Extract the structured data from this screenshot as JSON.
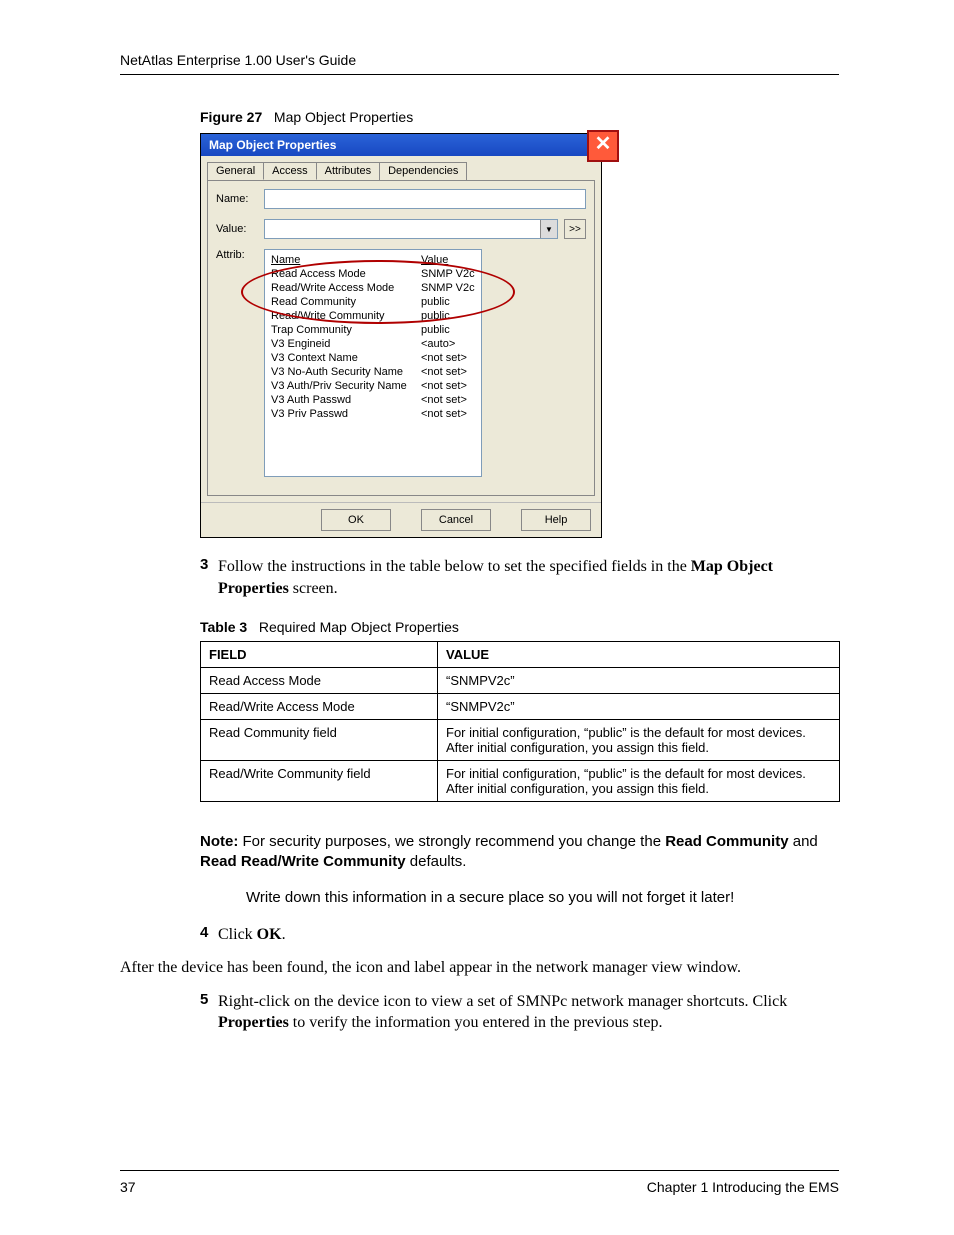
{
  "header": {
    "guide_title": "NetAtlas Enterprise 1.00 User's Guide"
  },
  "figure": {
    "label": "Figure 27",
    "title": "Map Object Properties"
  },
  "dialog": {
    "title": "Map Object Properties",
    "tabs": [
      "General",
      "Access",
      "Attributes",
      "Dependencies"
    ],
    "active_tab": 1,
    "labels": {
      "name": "Name:",
      "value": "Value:",
      "attrib": "Attrib:",
      "more": ">>"
    },
    "attrib_header": {
      "name": "Name",
      "value": "Value"
    },
    "attribs": [
      {
        "name": "Read Access Mode",
        "value": "SNMP V2c"
      },
      {
        "name": "Read/Write Access Mode",
        "value": "SNMP V2c"
      },
      {
        "name": "Read Community",
        "value": "public"
      },
      {
        "name": "Read/Write Community",
        "value": "public"
      },
      {
        "name": "Trap Community",
        "value": "public"
      },
      {
        "name": "V3 Engineid",
        "value": "<auto>"
      },
      {
        "name": "V3 Context Name",
        "value": "<not set>"
      },
      {
        "name": "V3 No-Auth Security Name",
        "value": "<not set>"
      },
      {
        "name": "V3 Auth/Priv Security Name",
        "value": "<not set>"
      },
      {
        "name": "V3 Auth Passwd",
        "value": "<not set>"
      },
      {
        "name": "V3 Priv Passwd",
        "value": "<not set>"
      }
    ],
    "buttons": {
      "ok": "OK",
      "cancel": "Cancel",
      "help": "Help"
    }
  },
  "step3": {
    "num": "3",
    "text_a": "Follow the instructions in the table below to set the specified fields in the ",
    "bold": "Map Object Properties",
    "text_b": " screen."
  },
  "table_caption": {
    "label": "Table 3",
    "title": "Required Map Object Properties"
  },
  "table": {
    "head": {
      "field": "FIELD",
      "value": "VALUE"
    },
    "rows": [
      {
        "field": "Read Access Mode",
        "value": "“SNMPV2c”"
      },
      {
        "field": "Read/Write Access Mode",
        "value": "“SNMPV2c”"
      },
      {
        "field": "Read Community field",
        "value": "For initial configuration, “public” is the default for most devices. After initial configuration, you assign this field."
      },
      {
        "field": "Read/Write Community field",
        "value": "For initial configuration, “public” is the default for most devices. After initial configuration, you assign this field."
      }
    ]
  },
  "note": {
    "prefix": "Note: ",
    "line1_a": "For security purposes, we strongly recommend you change the ",
    "bold1": "Read Community",
    "mid": " and ",
    "bold2": "Read Read/Write Community",
    "line1_b": " defaults.",
    "line2": "Write down this information in a secure place so you will not forget it later!"
  },
  "step4": {
    "num": "4",
    "text_a": "Click ",
    "bold": "OK",
    "text_b": "."
  },
  "para_after": "After the device has been found, the icon and label appear in the network manager view window.",
  "step5": {
    "num": "5",
    "text_a": "Right-click on the device icon to view a set of SMNPc network manager shortcuts. Click ",
    "bold": "Properties",
    "text_b": " to verify the information you entered in the previous step."
  },
  "footer": {
    "page": "37",
    "chapter": "Chapter 1 Introducing the EMS"
  }
}
